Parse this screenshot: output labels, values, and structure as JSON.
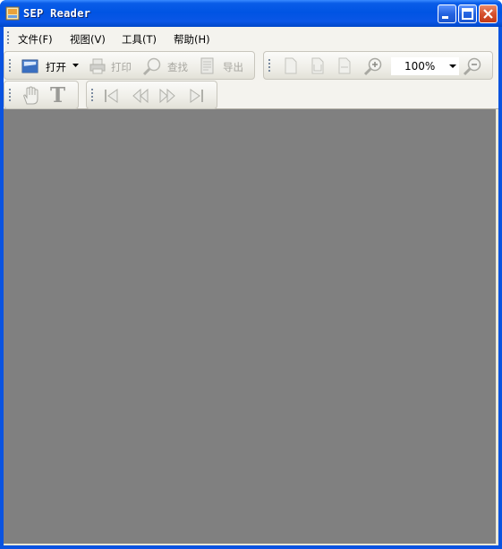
{
  "window": {
    "title": "SEP Reader",
    "accent": "#0054e3",
    "viewport_color": "#808080"
  },
  "titlebar_buttons": [
    {
      "name": "minimize-button",
      "icon": "minimize-icon"
    },
    {
      "name": "maximize-button",
      "icon": "maximize-icon"
    },
    {
      "name": "close-button",
      "icon": "close-icon"
    }
  ],
  "menu": {
    "file": "文件(F)",
    "view": "视图(V)",
    "tools": "工具(T)",
    "help": "帮助(H)"
  },
  "toolbar_main": {
    "open_label": "打开",
    "print_label": "打印",
    "find_label": "查找",
    "export_label": "导出"
  },
  "toolbar_view": {
    "zoom_value": "100%"
  },
  "toolbar_nav": {
    "icons": [
      "first-page-icon",
      "previous-page-icon",
      "next-page-icon",
      "last-page-icon"
    ]
  },
  "toolbar_tools": {
    "icons": [
      "hand-tool-icon",
      "text-select-icon"
    ]
  }
}
